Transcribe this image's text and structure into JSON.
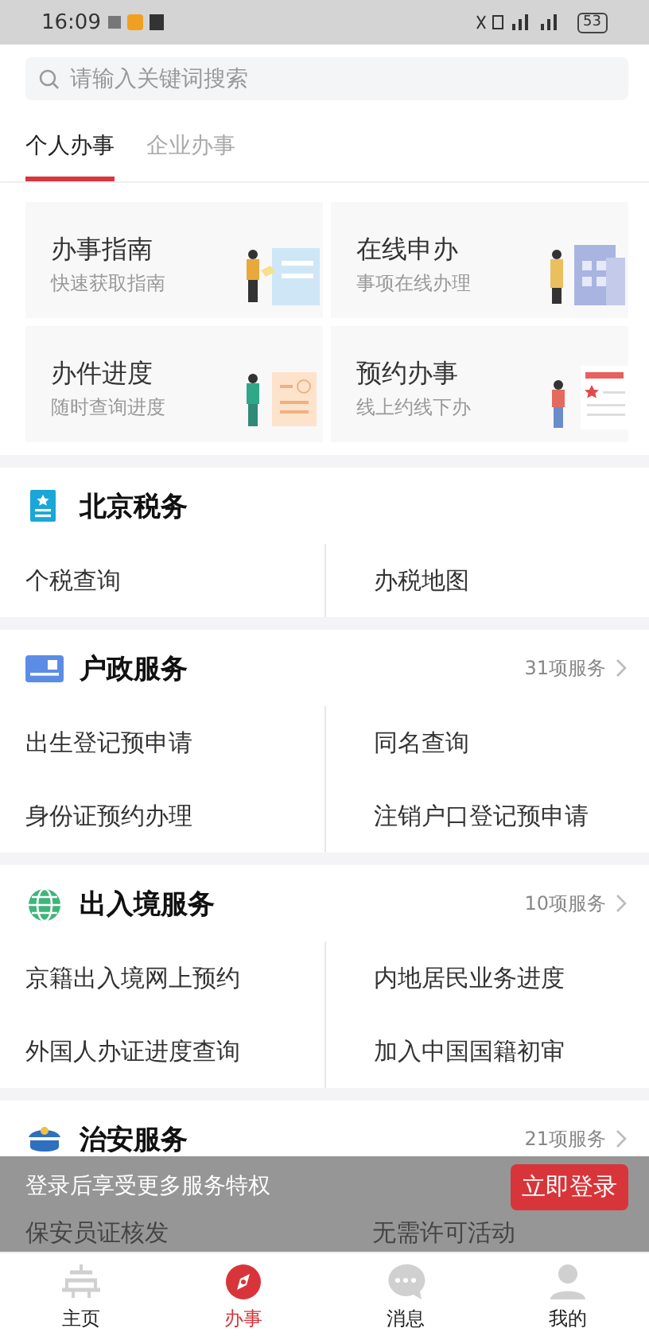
{
  "status_bar": {
    "time": "16:09",
    "battery": "53"
  },
  "search": {
    "placeholder": "请输入关键词搜索"
  },
  "tabs": [
    {
      "label": "个人办事",
      "selected": true
    },
    {
      "label": "企业办事",
      "selected": false
    }
  ],
  "cards": [
    {
      "title": "办事指南",
      "subtitle": "快速获取指南",
      "kind": "guide"
    },
    {
      "title": "在线申办",
      "subtitle": "事项在线办理",
      "kind": "online"
    },
    {
      "title": "办件进度",
      "subtitle": "随时查询进度",
      "kind": "progress"
    },
    {
      "title": "预约办事",
      "subtitle": "线上约线下办",
      "kind": "appointment"
    }
  ],
  "sections": [
    {
      "title": "北京税务",
      "kind": "tax",
      "items": [
        "个税查询",
        "办税地图"
      ]
    },
    {
      "title": "户政服务",
      "kind": "household",
      "count": "31项服务",
      "items": [
        "出生登记预申请",
        "同名查询",
        "身份证预约办理",
        "注销户口登记预申请"
      ]
    },
    {
      "title": "出入境服务",
      "kind": "border",
      "count": "10项服务",
      "items": [
        "京籍出入境网上预约",
        "内地居民业务进度",
        "外国人办证进度查询",
        "加入中国国籍初审"
      ]
    },
    {
      "title": "治安服务",
      "kind": "security",
      "count": "21项服务",
      "items": [
        "保安员证核发",
        "无需许可活动"
      ]
    }
  ],
  "login_banner": {
    "text": "登录后享受更多服务特权",
    "button": "立即登录"
  },
  "nav": [
    {
      "label": "主页",
      "kind": "home",
      "selected": false
    },
    {
      "label": "办事",
      "kind": "compass",
      "selected": true
    },
    {
      "label": "消息",
      "kind": "message",
      "selected": false
    },
    {
      "label": "我的",
      "kind": "user",
      "selected": false
    }
  ]
}
